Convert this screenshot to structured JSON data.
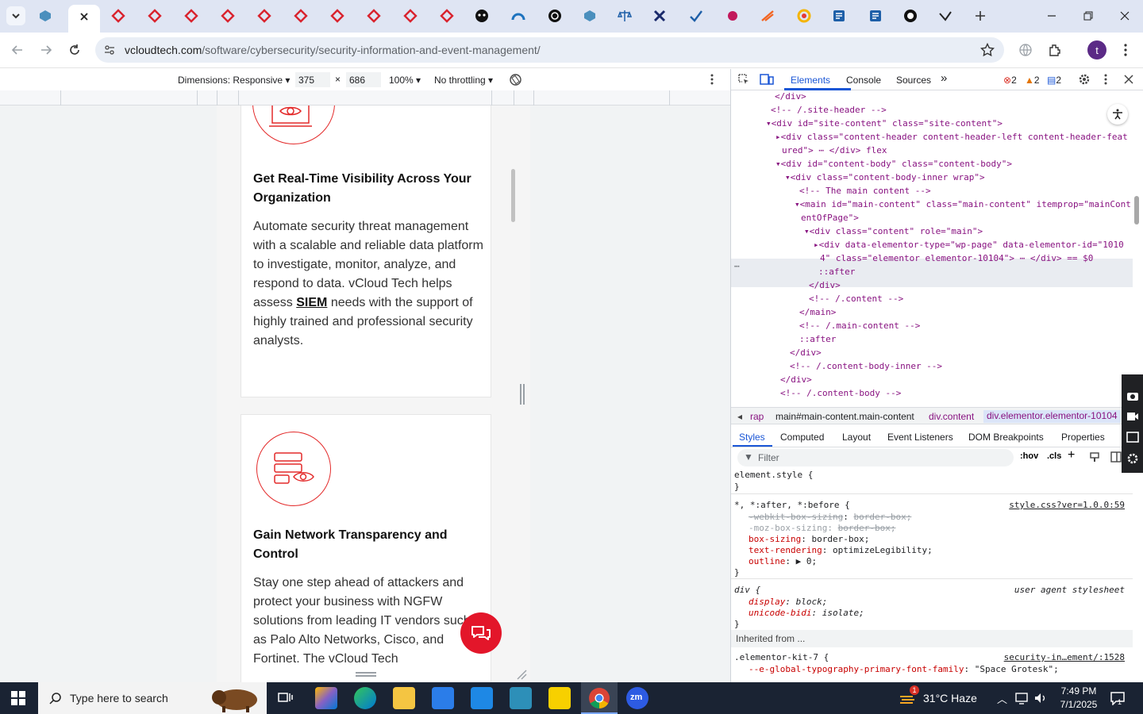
{
  "browser": {
    "url_host": "vcloudtech.com",
    "url_path": "/software/cybersecurity/security-information-and-event-management/",
    "profile_initial": "t"
  },
  "device_toolbar": {
    "dimensions_label": "Dimensions: Responsive",
    "width": "375",
    "height": "686",
    "zoom": "100%",
    "throttling": "No throttling"
  },
  "page": {
    "card1": {
      "title": "Get Real-Time Visibility Across Your Organization",
      "body_pre": "Automate security threat management with a scalable and reliable data platform to investigate, monitor, analyze, and respond to data.  vCloud Tech helps assess ",
      "body_link": "SIEM",
      "body_post": " needs with the support of highly trained and professional security analysts."
    },
    "card2": {
      "title": "Gain Network Transparency and Control",
      "body": "Stay one step ahead of attackers and protect your business with NGFW solutions from leading IT vendors such as Palo Alto Networks, Cisco, and Fortinet. The vCloud Tech"
    }
  },
  "devtools": {
    "tabs": [
      "Elements",
      "Console",
      "Sources"
    ],
    "errors": "2",
    "warnings": "2",
    "messages": "2",
    "dom_lines": [
      "</div>",
      "<!-- /.site-header -->",
      "▾<div id=\"site-content\" class=\"site-content\">",
      "▸<div class=\"content-header content-header-left content-header-feat",
      "ured\"> ⋯ </div>  flex",
      "▾<div id=\"content-body\" class=\"content-body\">",
      "▾<div class=\"content-body-inner wrap\">",
      "<!-- The main content -->",
      "▾<main id=\"main-content\" class=\"main-content\" itemprop=\"mainCont",
      "entOfPage\">",
      "▾<div class=\"content\" role=\"main\">",
      "▸<div data-elementor-type=\"wp-page\" data-elementor-id=\"1010",
      "4\" class=\"elementor elementor-10104\"> ⋯ </div> == $0",
      "::after",
      "</div>",
      "<!-- /.content -->",
      "</main>",
      "<!-- /.main-content -->",
      "::after",
      "</div>",
      "<!-- /.content-body-inner -->",
      "</div>",
      "<!-- /.content-body -->"
    ],
    "breadcrumbs": [
      "rap",
      "main#main-content.main-content",
      "div.content",
      "div.elementor.elementor-10104"
    ],
    "styles_tabs": [
      "Styles",
      "Computed",
      "Layout",
      "Event Listeners",
      "DOM Breakpoints",
      "Properties"
    ],
    "filter_placeholder": "Filter",
    "hov": ":hov",
    "cls": ".cls",
    "css": {
      "element_style": "element.style {",
      "close": "}",
      "rule1_selector": "*, *:after, *:before {",
      "rule1_source": "style.css?ver=1.0.0:59",
      "rule1_p1_name": "-webkit-box-sizing",
      "rule1_p1_val": "border-box;",
      "rule1_p2_name": "-moz-box-sizing",
      "rule1_p2_val": "border-box;",
      "rule1_p3_name": "box-sizing",
      "rule1_p3_val": "border-box;",
      "rule1_p4_name": "text-rendering",
      "rule1_p4_val": "optimizeLegibility;",
      "rule1_p5_name": "outline",
      "rule1_p5_val": "▶ 0;",
      "rule2_selector": "div {",
      "rule2_source": "user agent stylesheet",
      "rule2_p1_name": "display",
      "rule2_p1_val": "block;",
      "rule2_p2_name": "unicode-bidi",
      "rule2_p2_val": "isolate;",
      "inherited": "Inherited from ...",
      "rule3_selector": ".elementor-kit-7 {",
      "rule3_source": "security-in…ement/:1528",
      "rule3_p1_name": "--e-global-typography-primary-font-family",
      "rule3_p1_val": "\"Space Grotesk\";"
    }
  },
  "taskbar": {
    "search_placeholder": "Type here to search",
    "weather": "31°C  Haze",
    "time": "7:49 PM",
    "date": "7/1/2025",
    "notification_count": "1"
  },
  "colors": {
    "accent_red": "#e3162a",
    "devtools_blue": "#1a56d6",
    "taskbar": "#1a2333"
  }
}
